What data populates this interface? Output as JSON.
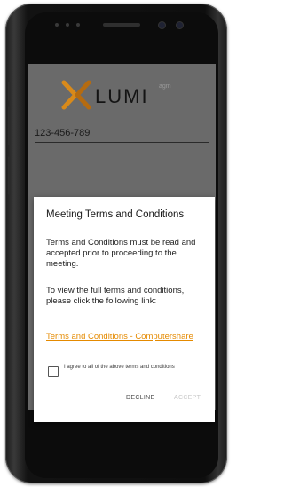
{
  "app": {
    "logo_text": "LUMI",
    "logo_superscript": "agm",
    "meeting_id": "123-456-789"
  },
  "dialog": {
    "title": "Meeting Terms and Conditions",
    "paragraph1": "Terms and Conditions must be read and accepted prior to proceeding to the meeting.",
    "paragraph2": "To view the full terms and conditions, please click the following link:",
    "link_text": "Terms and Conditions - Computershare",
    "checkbox_label": "I agree to all of the above terms and conditions",
    "decline_label": "DECLINE",
    "accept_label": "ACCEPT"
  },
  "colors": {
    "accent_link": "#e58a00",
    "logo_orange": "#d98a1a",
    "overlay_gray": "#6a6a6a"
  }
}
